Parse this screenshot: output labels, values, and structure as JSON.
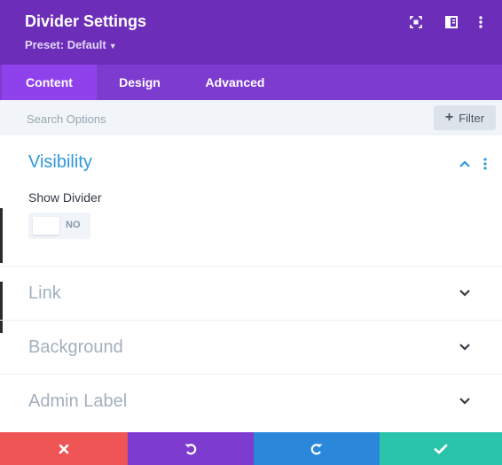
{
  "header": {
    "title": "Divider Settings",
    "preset": "Preset: Default",
    "color": "#6c2eb9",
    "icons": [
      "expand-icon",
      "split-view-icon",
      "more-options-icon"
    ]
  },
  "tabs": [
    {
      "label": "Content",
      "active": true
    },
    {
      "label": "Design",
      "active": false
    },
    {
      "label": "Advanced",
      "active": false
    }
  ],
  "search": {
    "placeholder": "Search Options",
    "value": "",
    "filter_label": "Filter"
  },
  "sections": {
    "visibility": {
      "title": "Visibility",
      "expanded": true,
      "fields": {
        "show_divider": {
          "label": "Show Divider",
          "value": "NO",
          "enabled": false
        }
      }
    },
    "link": {
      "title": "Link",
      "expanded": false
    },
    "background": {
      "title": "Background",
      "expanded": false
    },
    "admin_label": {
      "title": "Admin Label",
      "expanded": false
    }
  },
  "footer": {
    "buttons": [
      {
        "name": "cancel",
        "icon": "close-icon",
        "color": "#ef5555"
      },
      {
        "name": "undo",
        "icon": "undo-icon",
        "color": "#7e3bd0"
      },
      {
        "name": "redo",
        "icon": "redo-icon",
        "color": "#2b87da"
      },
      {
        "name": "save",
        "icon": "check-icon",
        "color": "#29c4a9"
      }
    ]
  }
}
